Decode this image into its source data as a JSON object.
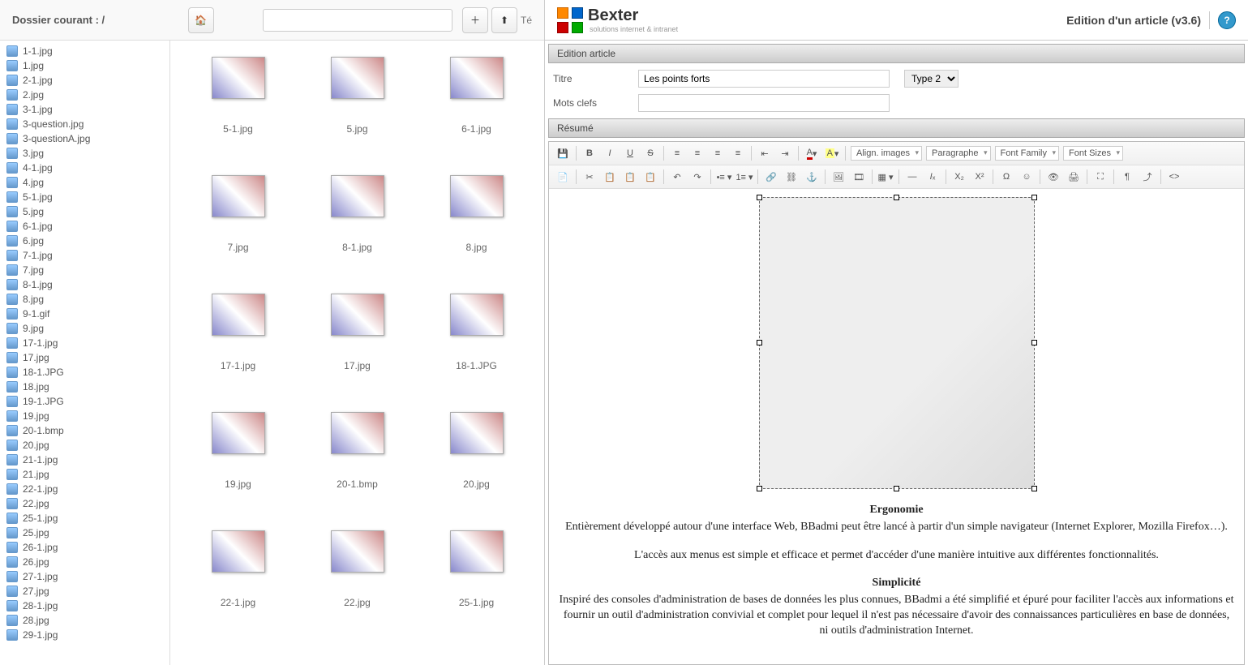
{
  "fileBrowser": {
    "folderLabel": "Dossier courant : /",
    "uploadLabelPartial": "Té",
    "files": [
      "1-1.jpg",
      "1.jpg",
      "2-1.jpg",
      "2.jpg",
      "3-1.jpg",
      "3-question.jpg",
      "3-questionA.jpg",
      "3.jpg",
      "4-1.jpg",
      "4.jpg",
      "5-1.jpg",
      "5.jpg",
      "6-1.jpg",
      "6.jpg",
      "7-1.jpg",
      "7.jpg",
      "8-1.jpg",
      "8.jpg",
      "9-1.gif",
      "9.jpg",
      "17-1.jpg",
      "17.jpg",
      "18-1.JPG",
      "18.jpg",
      "19-1.JPG",
      "19.jpg",
      "20-1.bmp",
      "20.jpg",
      "21-1.jpg",
      "21.jpg",
      "22-1.jpg",
      "22.jpg",
      "25-1.jpg",
      "25.jpg",
      "26-1.jpg",
      "26.jpg",
      "27-1.jpg",
      "27.jpg",
      "28-1.jpg",
      "28.jpg",
      "29-1.jpg"
    ],
    "thumbs": [
      [
        "5-1.jpg",
        "5.jpg",
        "6-1.jpg"
      ],
      [
        "7.jpg",
        "8-1.jpg",
        "8.jpg"
      ],
      [
        "17-1.jpg",
        "17.jpg",
        "18-1.JPG"
      ],
      [
        "19.jpg",
        "20-1.bmp",
        "20.jpg"
      ],
      [
        "22-1.jpg",
        "22.jpg",
        "25-1.jpg"
      ]
    ]
  },
  "editor": {
    "brand": "Bexter",
    "brandTagline": "solutions internet & intranet",
    "pageTitle": "Edition d'un article (v3.6)",
    "sections": {
      "edit": "Edition article",
      "resume": "Résumé"
    },
    "form": {
      "titreLabel": "Titre",
      "titreValue": "Les points forts",
      "typeLabel": "Type 2",
      "motsLabel": "Mots clefs",
      "motsValue": ""
    },
    "toolbar": {
      "alignImages": "Align. images",
      "paragraphe": "Paragraphe",
      "fontFamily": "Font Family",
      "fontSizes": "Font Sizes"
    },
    "article": {
      "h1": "Ergonomie",
      "p1": "Entièrement développé autour d'une interface Web, BBadmi peut être lancé à partir d'un simple navigateur (Internet Explorer, Mozilla Firefox…).",
      "p1b": "L'accès aux menus est simple et efficace et permet d'accéder d'une manière intuitive aux différentes fonctionnalités.",
      "h2": "Simplicité",
      "p2": "Inspiré des consoles d'administration de bases de données les plus connues, BBadmi a été simplifié et épuré pour faciliter l'accès aux informations et fournir un outil d'administration convivial et complet pour lequel il n'est pas nécessaire d'avoir des connaissances particulières en base de données, ni outils d'administration Internet."
    }
  }
}
